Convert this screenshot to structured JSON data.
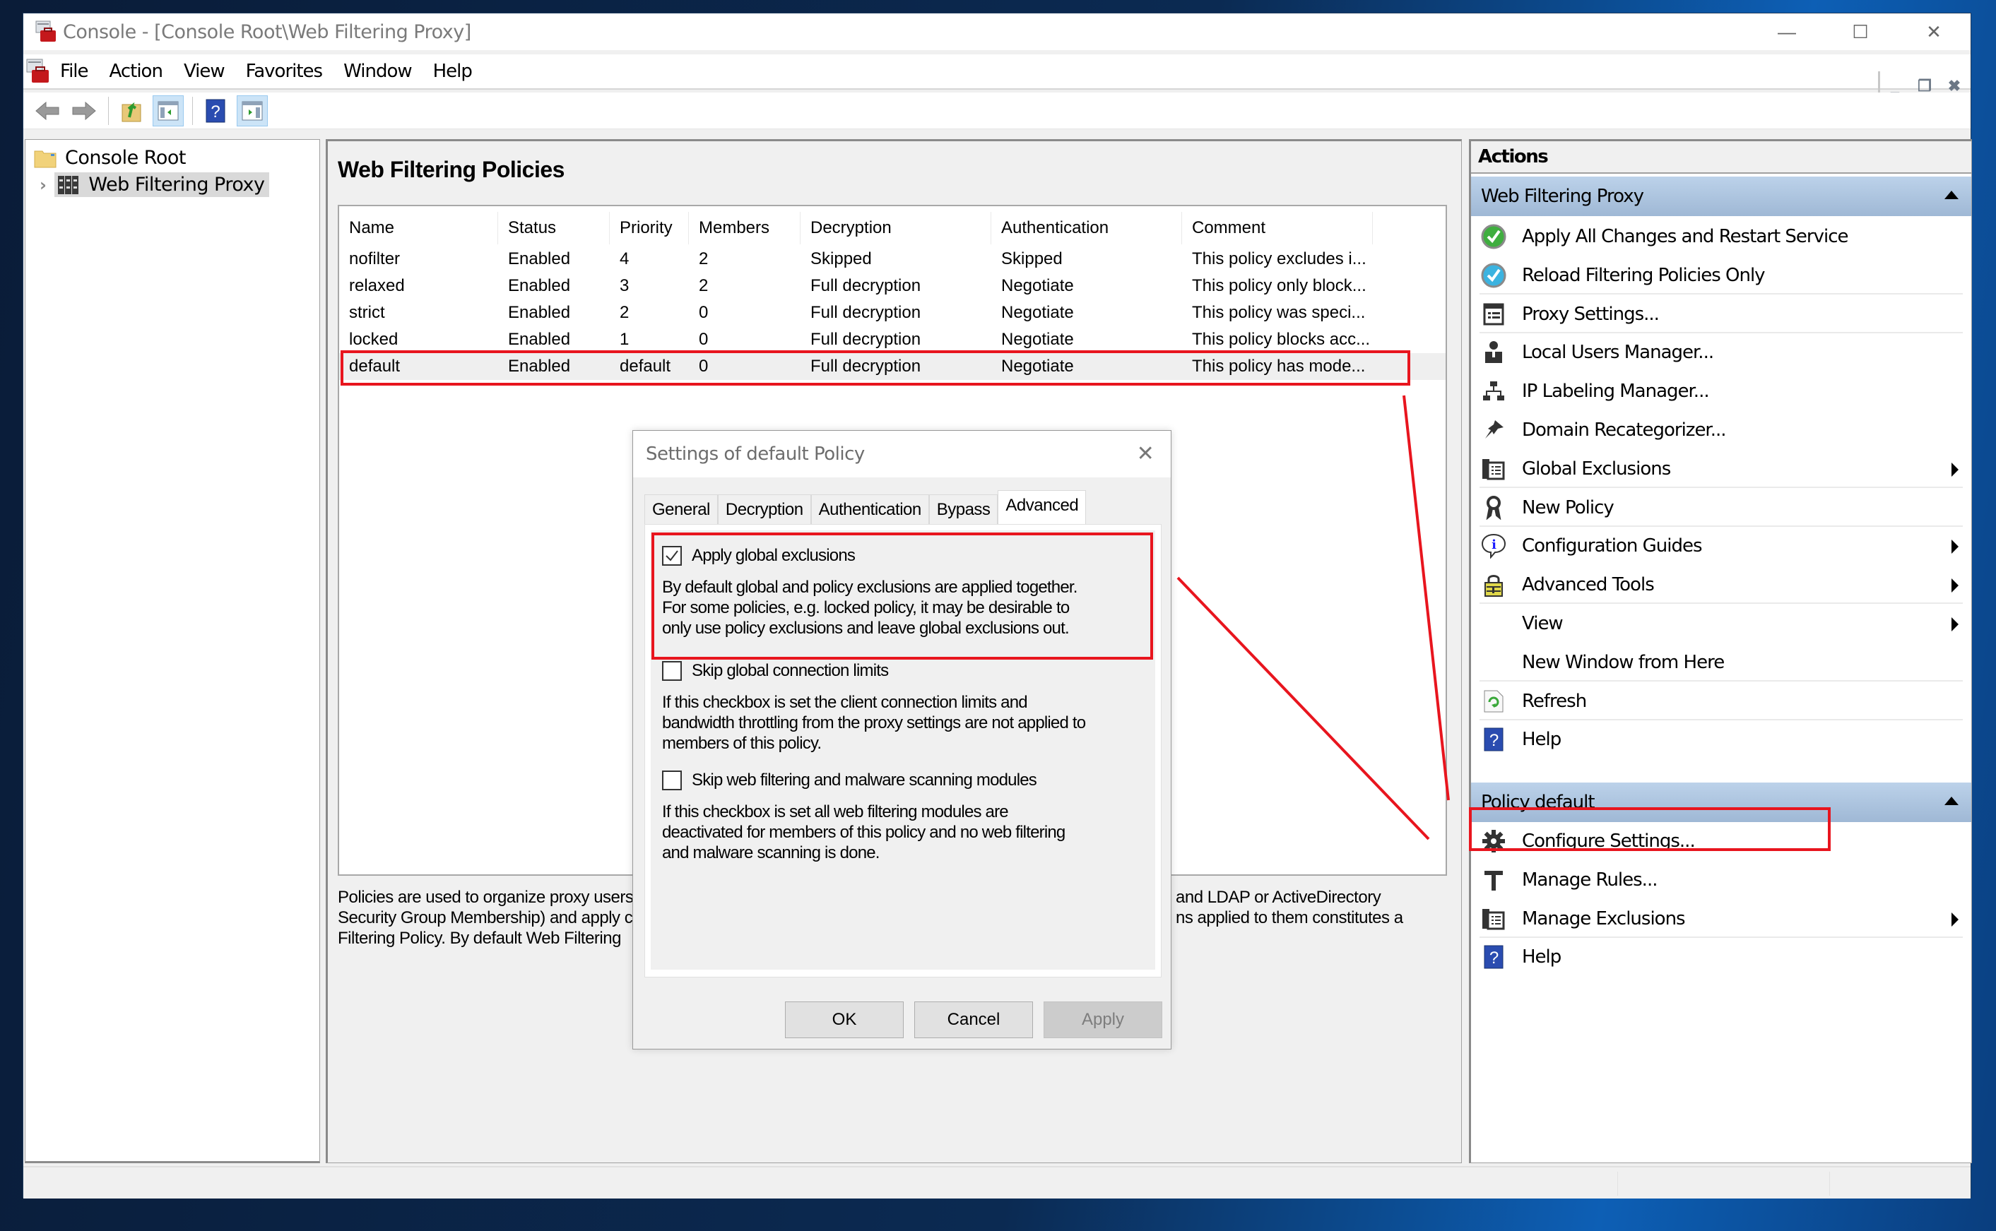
{
  "window": {
    "title": "Console - [Console Root\\Web Filtering Proxy]",
    "controls": {
      "minimize": "—",
      "maximize": "☐",
      "close": "✕"
    },
    "mdi_controls": {
      "minimize": "_",
      "restore": "❐",
      "close": "✖"
    }
  },
  "menubar": {
    "items": [
      "File",
      "Action",
      "View",
      "Favorites",
      "Window",
      "Help"
    ]
  },
  "toolbar": {
    "buttons": [
      "back-icon",
      "forward-icon",
      "up-folder-icon",
      "show-hide-tree-icon",
      "help-icon",
      "show-hide-action-pane-icon"
    ]
  },
  "tree": {
    "root": "Console Root",
    "child": "Web Filtering Proxy"
  },
  "center": {
    "title": "Web Filtering Policies",
    "columns": [
      "Name",
      "Status",
      "Priority",
      "Members",
      "Decryption",
      "Authentication",
      "Comment"
    ],
    "rows": [
      [
        "nofilter",
        "Enabled",
        "4",
        "2",
        "Skipped",
        "Skipped",
        "This policy excludes i..."
      ],
      [
        "relaxed",
        "Enabled",
        "3",
        "2",
        "Full decryption",
        "Negotiate",
        "This policy only block..."
      ],
      [
        "strict",
        "Enabled",
        "2",
        "0",
        "Full decryption",
        "Negotiate",
        "This policy was speci..."
      ],
      [
        "locked",
        "Enabled",
        "1",
        "0",
        "Full decryption",
        "Negotiate",
        "This policy blocks acc..."
      ],
      [
        "default",
        "Enabled",
        "default",
        "0",
        "Full decryption",
        "Negotiate",
        "This policy has mode..."
      ]
    ],
    "selected_row": 4,
    "description_left": [
      "Policies are used to organize proxy users",
      "Security Group Membership) and apply c",
      "Filtering Policy. By default Web Filtering"
    ],
    "description_right": [
      "and LDAP or ActiveDirectory",
      "ns applied to them constitutes a"
    ]
  },
  "actions": {
    "header": "Actions",
    "group1": {
      "title": "Web Filtering Proxy",
      "items": [
        {
          "label": "Apply All Changes and Restart Service",
          "icon": "green-check-icon",
          "submenu": false
        },
        {
          "label": "Reload Filtering Policies Only",
          "icon": "blue-check-icon",
          "submenu": false
        },
        {
          "label": "Proxy Settings...",
          "icon": "settings-form-icon",
          "submenu": false
        },
        {
          "label": "Local Users Manager...",
          "icon": "user-icon",
          "submenu": false
        },
        {
          "label": "IP Labeling Manager...",
          "icon": "network-icon",
          "submenu": false
        },
        {
          "label": "Domain Recategorizer...",
          "icon": "pin-icon",
          "submenu": false
        },
        {
          "label": "Global Exclusions",
          "icon": "exclusions-list-icon",
          "submenu": true
        },
        {
          "label": "New Policy",
          "icon": "ribbon-icon",
          "submenu": false
        },
        {
          "label": "Configuration Guides",
          "icon": "info-bubble-icon",
          "submenu": true
        },
        {
          "label": "Advanced Tools",
          "icon": "lock-icon",
          "submenu": true
        },
        {
          "label": "View",
          "icon": "",
          "submenu": true
        },
        {
          "label": "New Window from Here",
          "icon": "",
          "submenu": false
        },
        {
          "label": "Refresh",
          "icon": "refresh-icon",
          "submenu": false
        },
        {
          "label": "Help",
          "icon": "help-icon",
          "submenu": false
        }
      ]
    },
    "group2": {
      "title": "Policy default",
      "items": [
        {
          "label": "Configure Settings...",
          "icon": "gear-icon",
          "submenu": false
        },
        {
          "label": "Manage Rules...",
          "icon": "hammer-icon",
          "submenu": false
        },
        {
          "label": "Manage Exclusions",
          "icon": "exclusions-list-icon",
          "submenu": true
        },
        {
          "label": "Help",
          "icon": "help-icon",
          "submenu": false
        }
      ]
    }
  },
  "dialog": {
    "title": "Settings of default Policy",
    "tabs": [
      "General",
      "Decryption",
      "Authentication",
      "Bypass",
      "Advanced"
    ],
    "active_tab": "Advanced",
    "options": [
      {
        "label": "Apply global exclusions",
        "checked": true,
        "description": [
          "By default global and policy exclusions are applied together.",
          "For some policies, e.g. locked policy, it may be desirable to",
          "only use policy exclusions and leave global exclusions out."
        ]
      },
      {
        "label": "Skip global connection limits",
        "checked": false,
        "description": [
          "If this checkbox is set the client connection limits and",
          "bandwidth throttling from the proxy settings are not applied to",
          "members of this policy."
        ]
      },
      {
        "label": "Skip web filtering and malware scanning modules",
        "checked": false,
        "description": [
          "If this checkbox is set all web filtering modules are",
          "deactivated for members of this policy and no web filtering",
          "and malware scanning is done."
        ]
      }
    ],
    "buttons": {
      "ok": "OK",
      "cancel": "Cancel",
      "apply": "Apply"
    },
    "apply_enabled": false
  },
  "annotation_color": "#e8151e"
}
